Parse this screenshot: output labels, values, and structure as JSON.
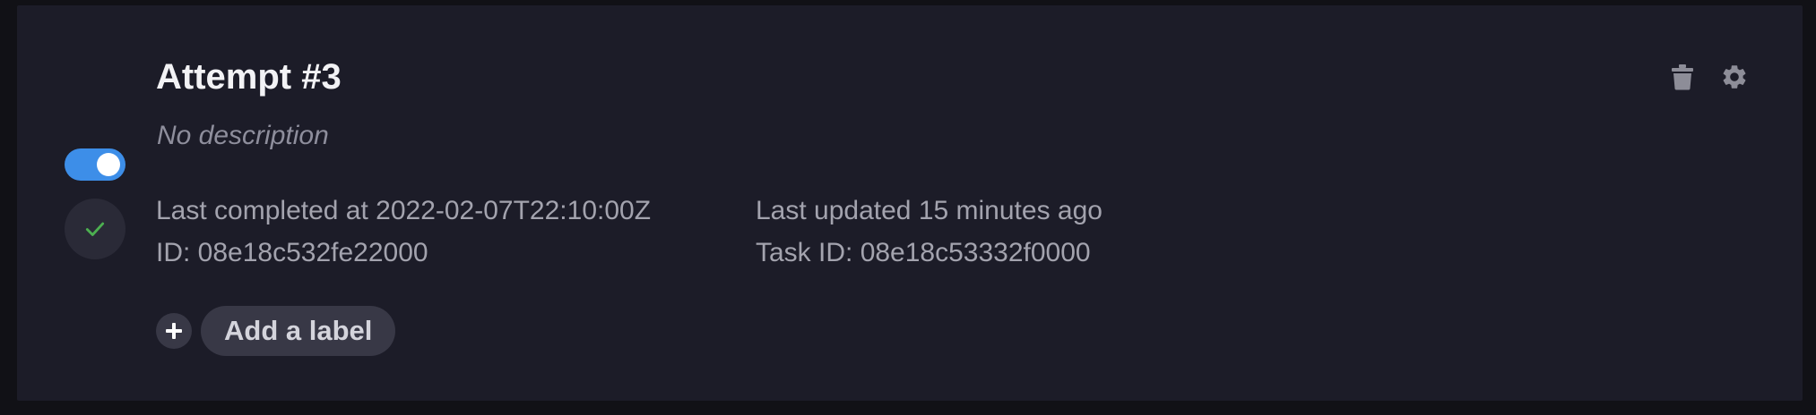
{
  "card": {
    "title": "Attempt #3",
    "description": "No description",
    "enabled": true,
    "status": "completed",
    "last_completed": "Last completed at 2022-02-07T22:10:00Z",
    "id": "ID: 08e18c532fe22000",
    "last_updated": "Last updated 15 minutes ago",
    "task_id": "Task ID: 08e18c53332f0000"
  },
  "actions": {
    "delete_icon": "trash-icon",
    "settings_icon": "gear-icon",
    "add_label": "Add a label",
    "add_label_icon": "plus-icon"
  },
  "colors": {
    "background": "#111116",
    "card": "#1c1c28",
    "toggle_on": "#3d8ee8",
    "success": "#4caf50",
    "text_primary": "#f2f2f5",
    "text_secondary": "#a3a3ae",
    "icon_muted": "#8d8d98"
  }
}
